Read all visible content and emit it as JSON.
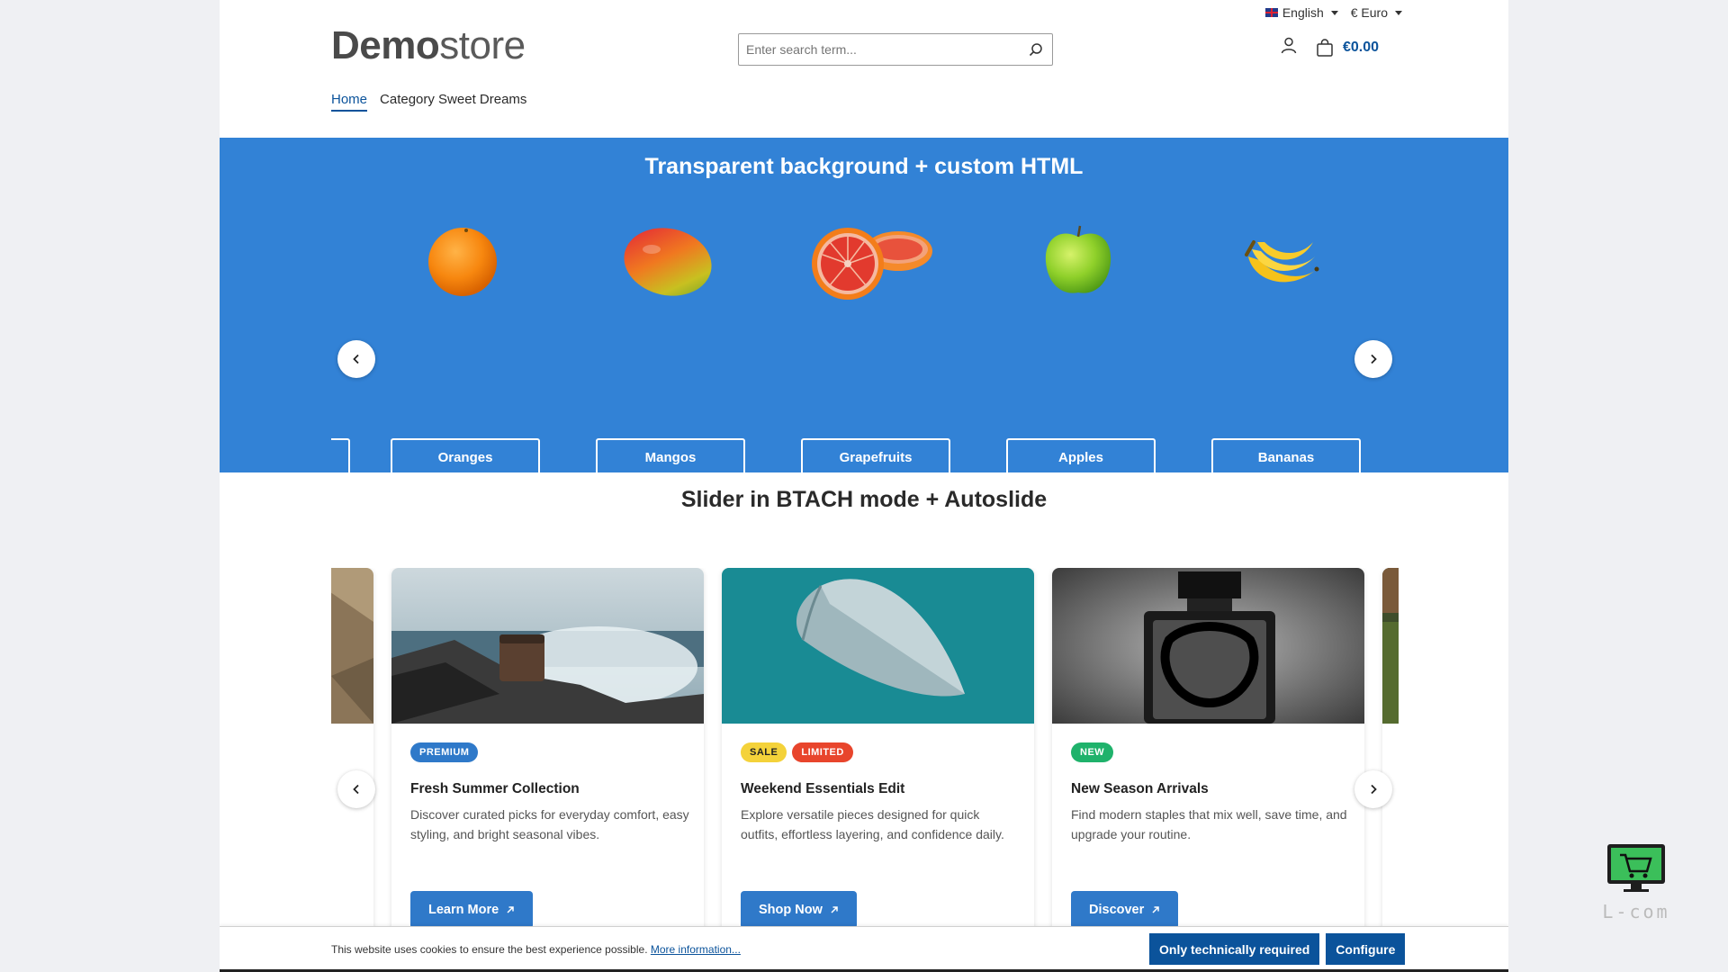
{
  "topbar": {
    "language": "English",
    "currency": "€ Euro"
  },
  "logo": {
    "bold": "Demo",
    "light": "store"
  },
  "search": {
    "placeholder": "Enter search term..."
  },
  "header": {
    "cart_total": "€0.00"
  },
  "nav": {
    "items": [
      "Home",
      "Category Sweet Dreams"
    ]
  },
  "fruit_slider": {
    "title": "Transparent background + custom HTML",
    "background": "#3282d6",
    "items": [
      {
        "label": "Oranges",
        "icon": "orange-icon"
      },
      {
        "label": "Mangos",
        "icon": "mango-icon"
      },
      {
        "label": "Grapefruits",
        "icon": "grapefruit-icon"
      },
      {
        "label": "Apples",
        "icon": "apple-icon"
      },
      {
        "label": "Bananas",
        "icon": "banana-icon"
      }
    ]
  },
  "card_slider": {
    "title": "Slider in BTACH mode + Autoslide",
    "cards": [
      {
        "badges": [
          {
            "text": "PREMIUM",
            "color": "#2f79c9"
          }
        ],
        "title": "Fresh Summer Collection",
        "description": "Discover curated picks for everyday comfort, easy styling, and bright seasonal vibes.",
        "button": "Learn More"
      },
      {
        "badges": [
          {
            "text": "SALE",
            "color": "#f4d23a"
          },
          {
            "text": "LIMITED",
            "color": "#e8452c"
          }
        ],
        "title": "Weekend Essentials Edit",
        "description": "Explore versatile pieces designed for quick outfits, effortless layering, and confidence daily.",
        "button": "Shop Now"
      },
      {
        "badges": [
          {
            "text": "NEW",
            "color": "#1fb26b"
          }
        ],
        "title": "New Season Arrivals",
        "description": "Find modern staples that mix well, save time, and upgrade your routine.",
        "button": "Discover"
      }
    ]
  },
  "cookie": {
    "text": "This website uses cookies to ensure the best experience possible.",
    "link": "More information...",
    "btn_required": "Only technically required",
    "btn_configure": "Configure"
  },
  "watermark": {
    "text": "L-com"
  },
  "colors": {
    "primary": "#0b539b",
    "button": "#2f79c9"
  }
}
